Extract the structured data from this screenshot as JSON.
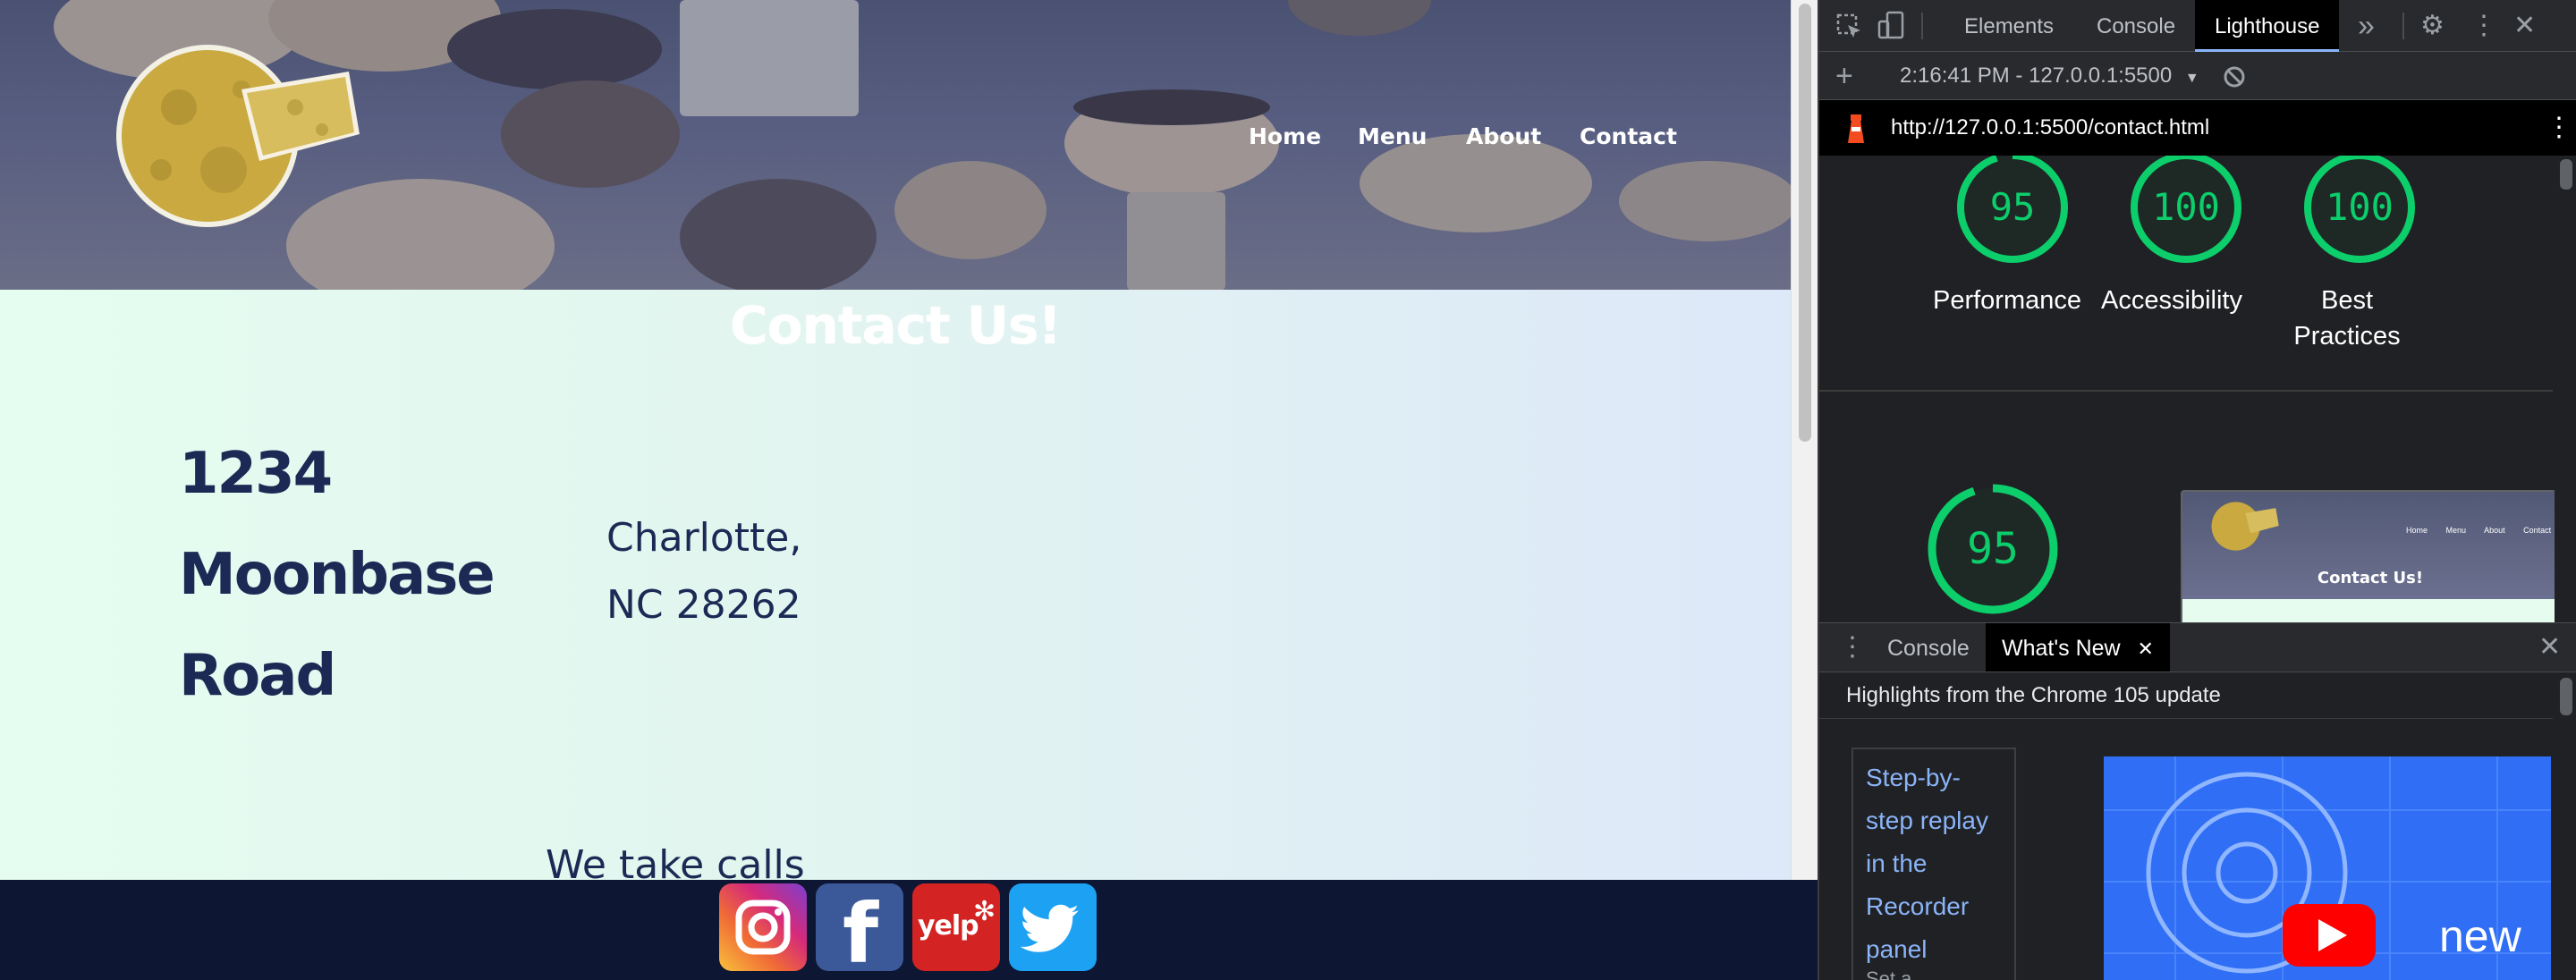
{
  "site": {
    "nav": {
      "home": "Home",
      "menu": "Menu",
      "about": "About",
      "contact": "Contact"
    },
    "title": "Contact Us!",
    "street_lines": [
      "1234",
      "Moonbase",
      "Road"
    ],
    "city_lines": [
      "Charlotte,",
      "NC 28262"
    ],
    "calls_text": "We take calls",
    "social": [
      {
        "name": "instagram",
        "icon": "instagram-icon"
      },
      {
        "name": "facebook",
        "icon": "facebook-icon",
        "glyph": "f"
      },
      {
        "name": "yelp",
        "icon": "yelp-icon",
        "glyph": "yelp"
      },
      {
        "name": "twitter",
        "icon": "twitter-icon"
      }
    ]
  },
  "devtools": {
    "tabs": {
      "elements": "Elements",
      "console": "Console",
      "lighthouse": "Lighthouse"
    },
    "more_tabs_glyph": "»",
    "report_time": "2:16:41 PM - 127.0.0.1:5500",
    "url": "http://127.0.0.1:5500/contact.html",
    "scores": [
      {
        "label_lines": [
          "Performance"
        ],
        "value": "95"
      },
      {
        "label_lines": [
          "Accessibility"
        ],
        "value": "100"
      },
      {
        "label_lines": [
          "Best",
          "Practices"
        ],
        "value": "100"
      }
    ],
    "big_score": "95",
    "preview": {
      "title": "Contact Us!",
      "nav": [
        "Home",
        "Menu",
        "About",
        "Contact"
      ]
    },
    "drawer": {
      "console": "Console",
      "whats_new": "What's New",
      "highlight": "Highlights from the Chrome 105 update",
      "card_link_lines": [
        "Step-by-",
        "step replay",
        "in the",
        "Recorder",
        "panel"
      ],
      "card_sub": "Set a",
      "video_text": "new"
    },
    "colors": {
      "score_green": "#0cce6b",
      "link_blue": "#8ab4f8",
      "active_tab_bg": "#000000"
    }
  }
}
